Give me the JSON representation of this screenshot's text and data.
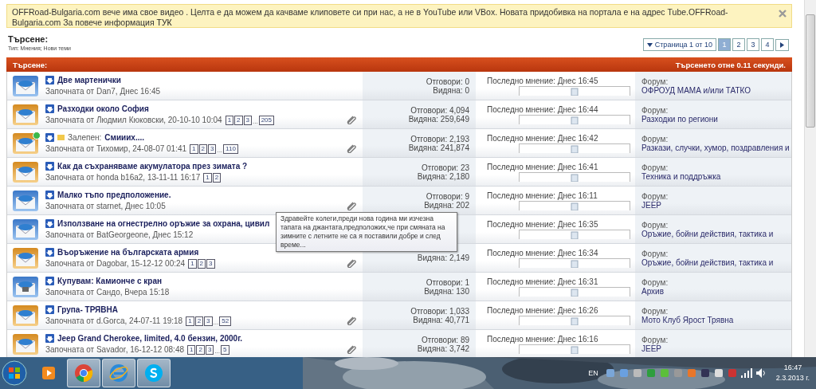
{
  "banner": {
    "text": "OFFRoad-Bulgaria.com вече има свое видео . Целта е да можем да качваме клиповете си при нас, а не в YouTube или VBox. Новата придобивка на портала е на адрес Tube.OFFRoad-Bulgaria.com За повече информация",
    "link": "ТУК"
  },
  "header": {
    "title": "Търсене:",
    "subtitle": "Тип: Мнения; Нови теми"
  },
  "pager": {
    "label": "Страница 1 от 10",
    "pages": [
      {
        "label": "1",
        "selected": true
      },
      {
        "label": "2",
        "selected": false
      },
      {
        "label": "3",
        "selected": false
      },
      {
        "label": "4",
        "selected": false
      }
    ]
  },
  "results_bar": {
    "title": "Търсене:",
    "time": "Търсенето отне 0.11 секунди."
  },
  "threads": [
    {
      "kind": "new",
      "title": "Две мартенички",
      "starter": "Започната от Dan7, Днес 16:45",
      "replies": "Отговори: 0",
      "views": "Видяна: 0",
      "last_post": "Последно мнение: Днес 16:45",
      "forum_label": "Форум:",
      "forum": "ОФРОУД МАМА и/или ТАТКО"
    },
    {
      "kind": "hot",
      "title": "Разходки около София",
      "starter": "Започната от Людмил Кюковски, 20-10-10 10:04",
      "pages": [
        {
          "label": "1",
          "kind": "page"
        },
        {
          "label": "2",
          "kind": "page"
        },
        {
          "label": "3",
          "kind": "page"
        },
        {
          "label": "...",
          "kind": "gap"
        },
        {
          "label": "205",
          "kind": "page"
        }
      ],
      "attachment": true,
      "replies": "Отговори: 4,094",
      "views": "Видяна: 259,649",
      "last_post": "Последно мнение: Днес 16:44",
      "forum_label": "Форум:",
      "forum": "Разходки по региони"
    },
    {
      "kind": "hot",
      "badge": true,
      "prefix": "Залепен:",
      "title": "Смииих....",
      "starter": "Започната от Тихомир, 24-08-07 01:41",
      "pages": [
        {
          "label": "1",
          "kind": "page"
        },
        {
          "label": "2",
          "kind": "page"
        },
        {
          "label": "3",
          "kind": "page"
        },
        {
          "label": "...",
          "kind": "gap"
        },
        {
          "label": "110",
          "kind": "page"
        }
      ],
      "attachment": true,
      "replies": "Отговори: 2,193",
      "views": "Видяна: 241,874",
      "last_post": "Последно мнение: Днес 16:42",
      "forum_label": "Форум:",
      "forum": "Разкази, случки, хумор, поздравления и"
    },
    {
      "kind": "hot",
      "title": "Как да съхраняваме акумулатора през зимата ?",
      "starter": "Започната от honda b16a2, 13-11-11 16:17",
      "pages": [
        {
          "label": "1",
          "kind": "page"
        },
        {
          "label": "2",
          "kind": "page"
        }
      ],
      "replies": "Отговори: 23",
      "views": "Видяна: 2,180",
      "last_post": "Последно мнение: Днес 16:41",
      "forum_label": "Форум:",
      "forum": "Техника и поддръжка"
    },
    {
      "kind": "new",
      "title": "Малко тъпо предположение.",
      "starter": "Започната от starnet, Днес 10:05",
      "attachment": true,
      "replies": "Отговори: 9",
      "views": "Видяна: 202",
      "last_post": "Последно мнение: Днес 16:11",
      "forum_label": "Форум:",
      "forum": "JEEP"
    },
    {
      "kind": "new",
      "title": "Използване на огнестрелно оръжие за охрана, цивил",
      "starter": "Започната от BatGeorgeone, Днес 15:12",
      "last_post": "Последно мнение: Днес 16:35",
      "forum_label": "Форум:",
      "forum": "Оръжие, бойни действия, тактика и"
    },
    {
      "kind": "hot",
      "title": "Въоръжение на българската армия",
      "starter": "Започната от Dagobar, 15-12-12 00:24",
      "pages": [
        {
          "label": "1",
          "kind": "page"
        },
        {
          "label": "2",
          "kind": "page"
        },
        {
          "label": "3",
          "kind": "page"
        }
      ],
      "attachment": true,
      "views": "Видяна: 2,149",
      "last_post": "Последно мнение: Днес 16:34",
      "forum_label": "Форум:",
      "forum": "Оръжие, бойни действия, тактика и"
    },
    {
      "kind": "locked",
      "title": "Купувам: Камионче с кран",
      "starter": "Започната от Сандо, Вчера 15:18",
      "replies": "Отговори: 1",
      "views": "Видяна: 130",
      "last_post": "Последно мнение: Днес 16:31",
      "forum_label": "Форум:",
      "forum": "Архив"
    },
    {
      "kind": "hot",
      "title": "Група- ТРЯВНА",
      "starter": "Започната от d.Gorca, 24-07-11 19:18",
      "pages": [
        {
          "label": "1",
          "kind": "page"
        },
        {
          "label": "2",
          "kind": "page"
        },
        {
          "label": "3",
          "kind": "page"
        },
        {
          "label": "...",
          "kind": "gap"
        },
        {
          "label": "52",
          "kind": "page"
        }
      ],
      "attachment": true,
      "replies": "Отговори: 1,033",
      "views": "Видяна: 40,771",
      "last_post": "Последно мнение: Днес 16:26",
      "forum_label": "Форум:",
      "forum": "Мото Клуб Ярост Трявна"
    },
    {
      "kind": "hot",
      "title": "Jeep Grand Cherokee, limited, 4.0 бензин, 2000г.",
      "starter": "Започната от Savador, 16-12-12 08:48",
      "pages": [
        {
          "label": "1",
          "kind": "page"
        },
        {
          "label": "2",
          "kind": "page"
        },
        {
          "label": "3",
          "kind": "page"
        },
        {
          "label": "...",
          "kind": "gap"
        },
        {
          "label": "5",
          "kind": "page"
        }
      ],
      "attachment": true,
      "replies": "Отговори: 89",
      "views": "Видяна: 3,742",
      "last_post": "Последно мнение: Днес 16:16",
      "forum_label": "Форум:",
      "forum": "JEEP"
    }
  ],
  "tooltip": {
    "text": "Здравейте колеги,преди нова година ми изчезна тапата на джантата,предположих,че при смяната на зимните с летните не са я поставили добре и след време..."
  },
  "taskbar": {
    "apps": [
      {
        "kind": "media",
        "selected": false
      },
      {
        "kind": "chrome",
        "selected": true
      },
      {
        "kind": "ie",
        "selected": true
      },
      {
        "kind": "skype",
        "selected": true
      }
    ],
    "language": "EN",
    "time": "16:47",
    "date": "2.3.2013 г."
  }
}
